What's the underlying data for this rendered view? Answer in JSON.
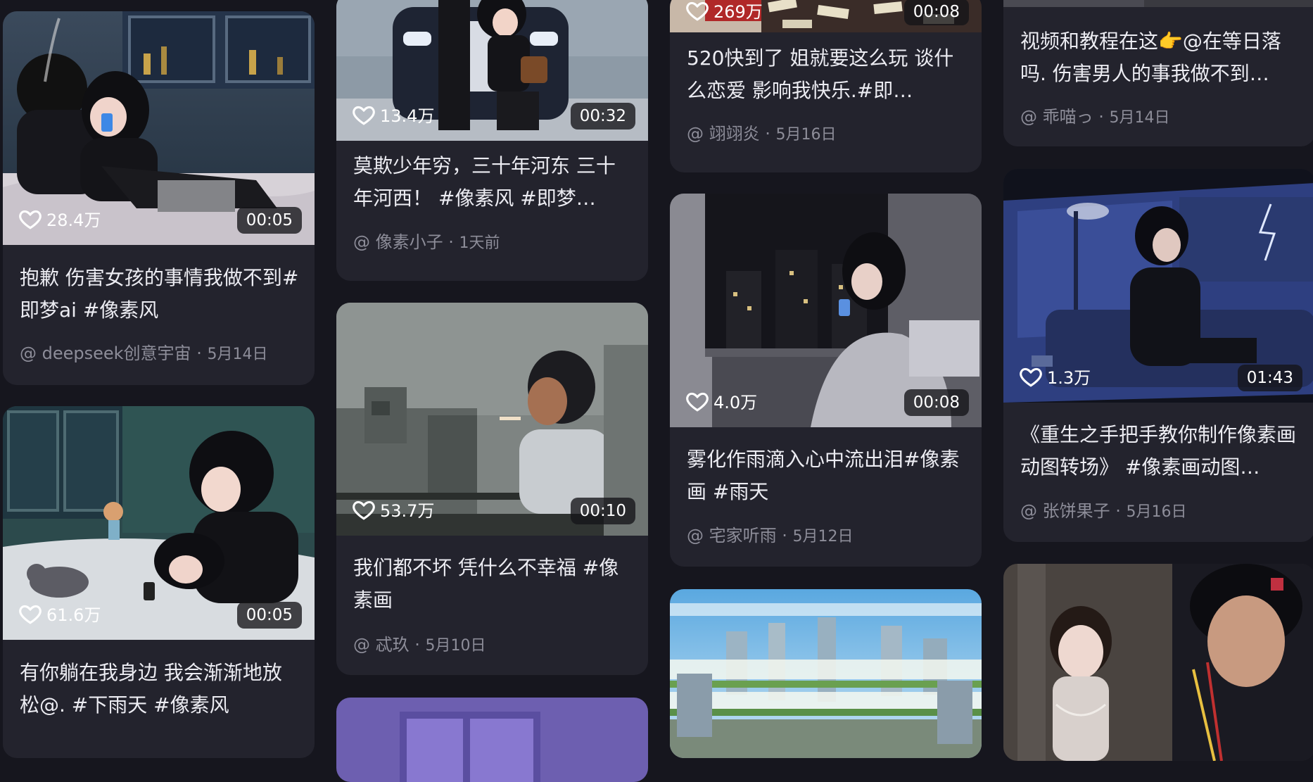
{
  "colors": {
    "background": "#16161e",
    "card": "#23232d",
    "text": "#ececf2",
    "meta": "#8d8d99"
  },
  "cards": [
    {
      "likes": "28.4万",
      "duration": "00:05",
      "title": "抱歉 伤害女孩的事情我做不到#即梦ai #像素风",
      "author": "@ deepseek创意宇宙",
      "date": "5月14日"
    },
    {
      "likes": "61.6万",
      "duration": "00:05",
      "title": "有你躺在我身边 我会渐渐地放松@. #下雨天 #像素风",
      "author": "",
      "date": ""
    },
    {
      "likes": "13.4万",
      "duration": "00:32",
      "title": "莫欺少年穷，三十年河东 三十年河西！ #像素风 #即梦…",
      "author": "@ 像素小子",
      "date": "1天前"
    },
    {
      "likes": "53.7万",
      "duration": "00:10",
      "title": "我们都不坏 凭什么不幸福 #像素画",
      "author": "@ 忒玖",
      "date": "5月10日"
    },
    {
      "likes": "269万",
      "duration": "00:08",
      "title": "520快到了 姐就要这么玩 谈什么恋爱 影响我快乐.#即…",
      "author": "@ 翊翊炎",
      "date": "5月16日"
    },
    {
      "likes": "4.0万",
      "duration": "00:08",
      "title": "雾化作雨滴入心中流出泪#像素画 #雨天",
      "author": "@ 宅家听雨",
      "date": "5月12日"
    },
    {
      "likes": "",
      "duration": "",
      "title": "视频和教程在这👉@在等日落吗. 伤害男人的事我做不到…",
      "author": "@ 乖喵っ",
      "date": "5月14日"
    },
    {
      "likes": "1.3万",
      "duration": "01:43",
      "title": "《重生之手把手教你制作像素画动图转场》 #像素画动图…",
      "author": "@ 张饼果子",
      "date": "5月16日"
    }
  ]
}
